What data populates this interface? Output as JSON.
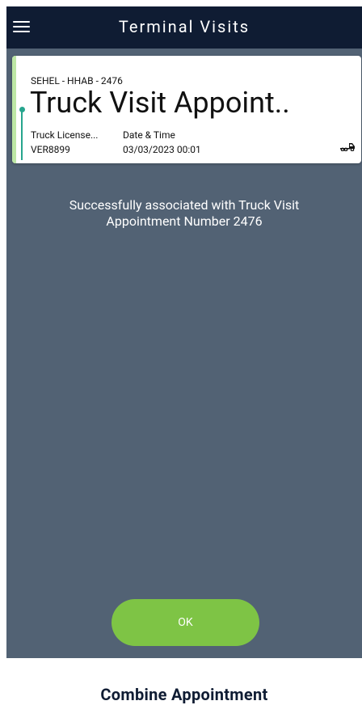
{
  "header": {
    "title": "Terminal Visits",
    "menu_icon": "menu-icon"
  },
  "card": {
    "facility": "SEHEL - HHAB - 2476",
    "title": "Truck Visit Appoint..",
    "fields": [
      {
        "label": "Truck License...",
        "value": "VER8899"
      },
      {
        "label": "Date & Time",
        "value": "03/03/2023 00:01"
      }
    ],
    "icon": "truck-icon"
  },
  "message": "Successfully associated with Truck Visit Appointment Number 2476",
  "actions": {
    "ok_label": "OK"
  },
  "bottom": {
    "title": "Combine Appointment"
  },
  "colors": {
    "header": "#0f1c33",
    "content_background": "#526274",
    "accent": "#27a58e",
    "button": "#7ec445"
  }
}
